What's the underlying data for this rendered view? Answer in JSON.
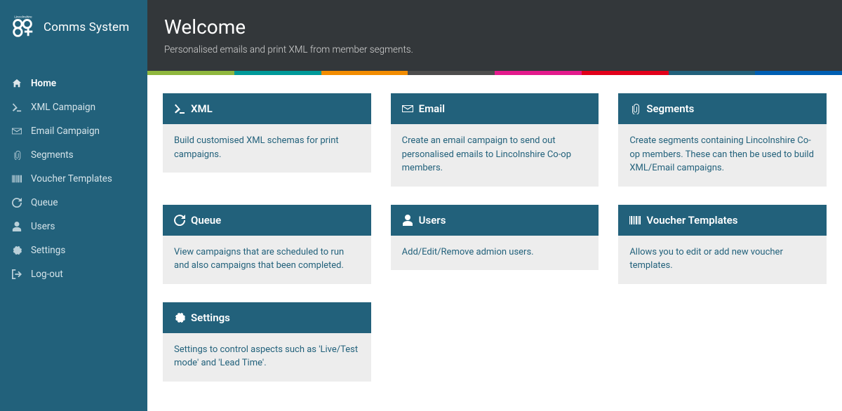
{
  "brand": {
    "logo_top_text": "Lincolnshire",
    "title": "Comms System"
  },
  "sidebar": {
    "items": [
      {
        "label": "Home",
        "icon": "home",
        "active": true
      },
      {
        "label": "XML Campaign",
        "icon": "terminal",
        "active": false
      },
      {
        "label": "Email Campaign",
        "icon": "envelope",
        "active": false
      },
      {
        "label": "Segments",
        "icon": "paperclip",
        "active": false
      },
      {
        "label": "Voucher Templates",
        "icon": "barcode",
        "active": false
      },
      {
        "label": "Queue",
        "icon": "refresh",
        "active": false
      },
      {
        "label": "Users",
        "icon": "user",
        "active": false
      },
      {
        "label": "Settings",
        "icon": "gear",
        "active": false
      },
      {
        "label": "Log-out",
        "icon": "logout",
        "active": false
      }
    ]
  },
  "header": {
    "title": "Welcome",
    "subtitle": "Personalised emails and print XML from member segments."
  },
  "stripe_colors": [
    "#8fb73e",
    "#009999",
    "#f28c00",
    "#4d4d4d",
    "#e31b8c",
    "#e2001a",
    "#22617b",
    "#005fb3"
  ],
  "cards": [
    {
      "icon": "terminal",
      "title": "XML",
      "body": "Build customised XML schemas for print campaigns."
    },
    {
      "icon": "envelope",
      "title": "Email",
      "body": "Create an email campaign to send out personalised emails to Lincolnshire Co-op members."
    },
    {
      "icon": "paperclip",
      "title": "Segments",
      "body": "Create segments containing Lincolnshire Co-op members. These can then be used to build XML/Email campaigns."
    },
    {
      "icon": "refresh",
      "title": "Queue",
      "body": "View campaigns that are scheduled to run and also campaigns that been completed."
    },
    {
      "icon": "user",
      "title": "Users",
      "body": "Add/Edit/Remove admion users."
    },
    {
      "icon": "barcode",
      "title": "Voucher Templates",
      "body": "Allows you to edit or add new voucher templates."
    },
    {
      "icon": "gear",
      "title": "Settings",
      "body": "Settings to control aspects such as 'Live/Test mode' and 'Lead Time'."
    }
  ]
}
